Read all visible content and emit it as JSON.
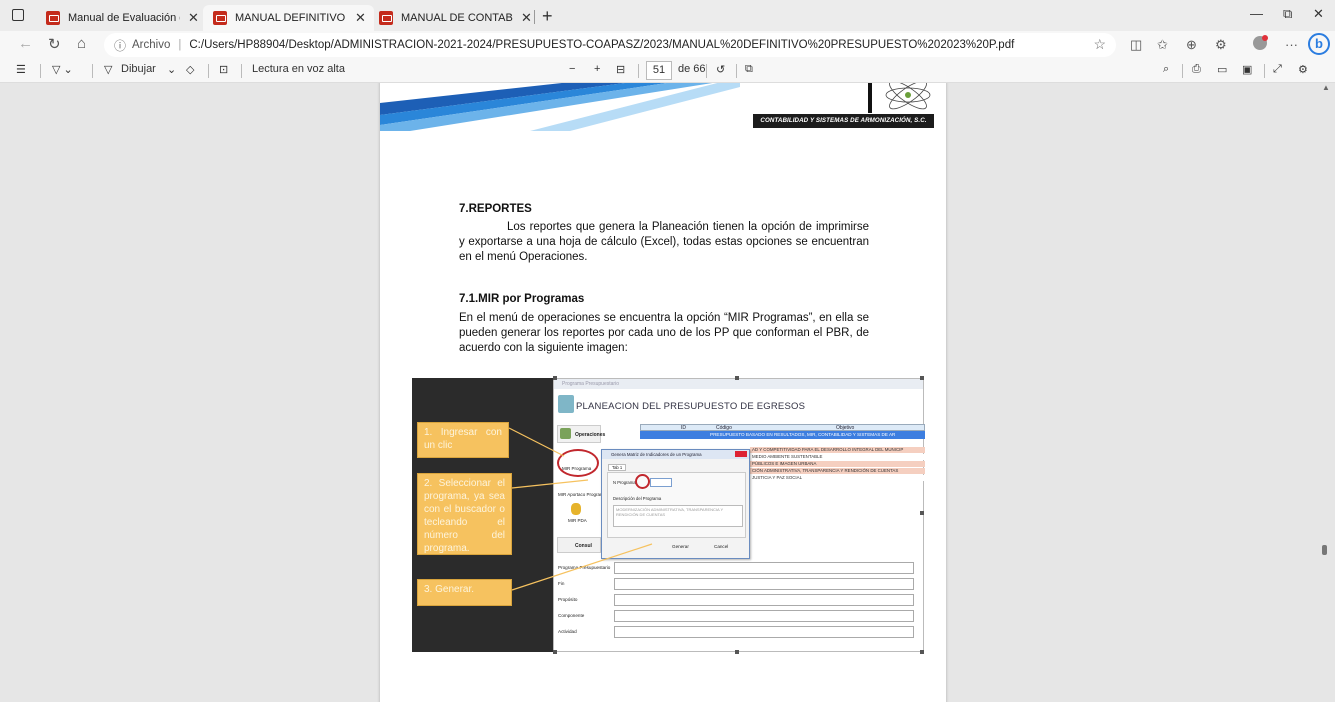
{
  "browser": {
    "tabs": [
      {
        "label": "Manual de Evaluación de Registr",
        "active": false
      },
      {
        "label": "MANUAL DEFINITIVO PRESUPU",
        "active": true
      },
      {
        "label": "MANUAL DE CONTABILIDAD DE",
        "active": false
      }
    ],
    "address": {
      "scheme": "Archivo",
      "url": "C:/Users/HP88904/Desktop/ADMINISTRACION-2021-2024/PRESUPUESTO-COAPASZ/2023/MANUAL%20DEFINITIVO%20PRESUPUESTO%202023%20P.pdf"
    },
    "profile_badge_color": "#e0313a",
    "bing_label": "b"
  },
  "pdf_toolbar": {
    "draw_label": "Dibujar",
    "read_aloud_label": "Lectura en voz alta",
    "page_number": "51",
    "page_total": "de 66"
  },
  "page": {
    "header_band": "CONTABILIDAD Y SISTEMAS DE ARMONIZACIÓN, S.C.",
    "section_heading": "7.REPORTES",
    "section_text": "Los reportes que genera la Planeación tienen la opción de imprimirse y exportarse a una hoja de cálculo (Excel), todas estas opciones se encuentran en el menú Operaciones.",
    "subsection_heading": "7.1.MIR por Programas",
    "subsection_text": "En el menú de operaciones se encuentra la opción “MIR Programas”, en ella se pueden generar los reportes por cada uno de los PP que conforman el PBR, de acuerdo con la siguiente imagen:"
  },
  "figure": {
    "callouts": [
      "1. Ingresar con un clic",
      "2. Seleccionar el programa, ya sea con el buscador o tecleando el número del programa.",
      "3. Generar."
    ],
    "app_window_title": "Programa Presupuestario",
    "app_heading": "PLANEACION DEL PRESUPUESTO DE EGRESOS",
    "operations_label": "Operaciones",
    "sidebar_items": [
      "MIR Programa",
      "MIR Aportaco Program",
      "MIR PDA"
    ],
    "consult_label": "Consul",
    "grid_headers": [
      "ID",
      "Código",
      "Objetivo"
    ],
    "grid_selected_row": "PRESUPUESTO BASADO EN RESULTADOS, MIR, CONTABILIDAD Y SISTEMAS DE AR",
    "grid_rows": [
      "AD Y COMPETITIVIDAD PARA EL DESARROLLO INTEGRAL DEL MUNICIP",
      "MEDIO AMBIENTE SUSTENTABLE",
      "PÚBLICOS E IMAGEN URBANA",
      "CIÓN ADMINISTRATIVA, TRANSPARENCIA Y RENDICIÓN DE CUENTAS",
      "JUSTICIA Y PAZ SOCIAL"
    ],
    "dialog": {
      "title": "Genera Matriz de Indicadores de un Programa",
      "tab": "Tab 1",
      "program_label": "N Programa",
      "description_label": "Descripción del Programa",
      "description_value": "MODERNIZACIÓN ADMINISTRATIVA, TRANSPARENCIA Y RENDICIÓN DE CUENTAS",
      "generate_label": "Generar",
      "cancel_label": "Cancel"
    },
    "form_labels": [
      "Programa Presupuestario",
      "Fin",
      "Propósito",
      "Componente",
      "Actividad"
    ]
  }
}
